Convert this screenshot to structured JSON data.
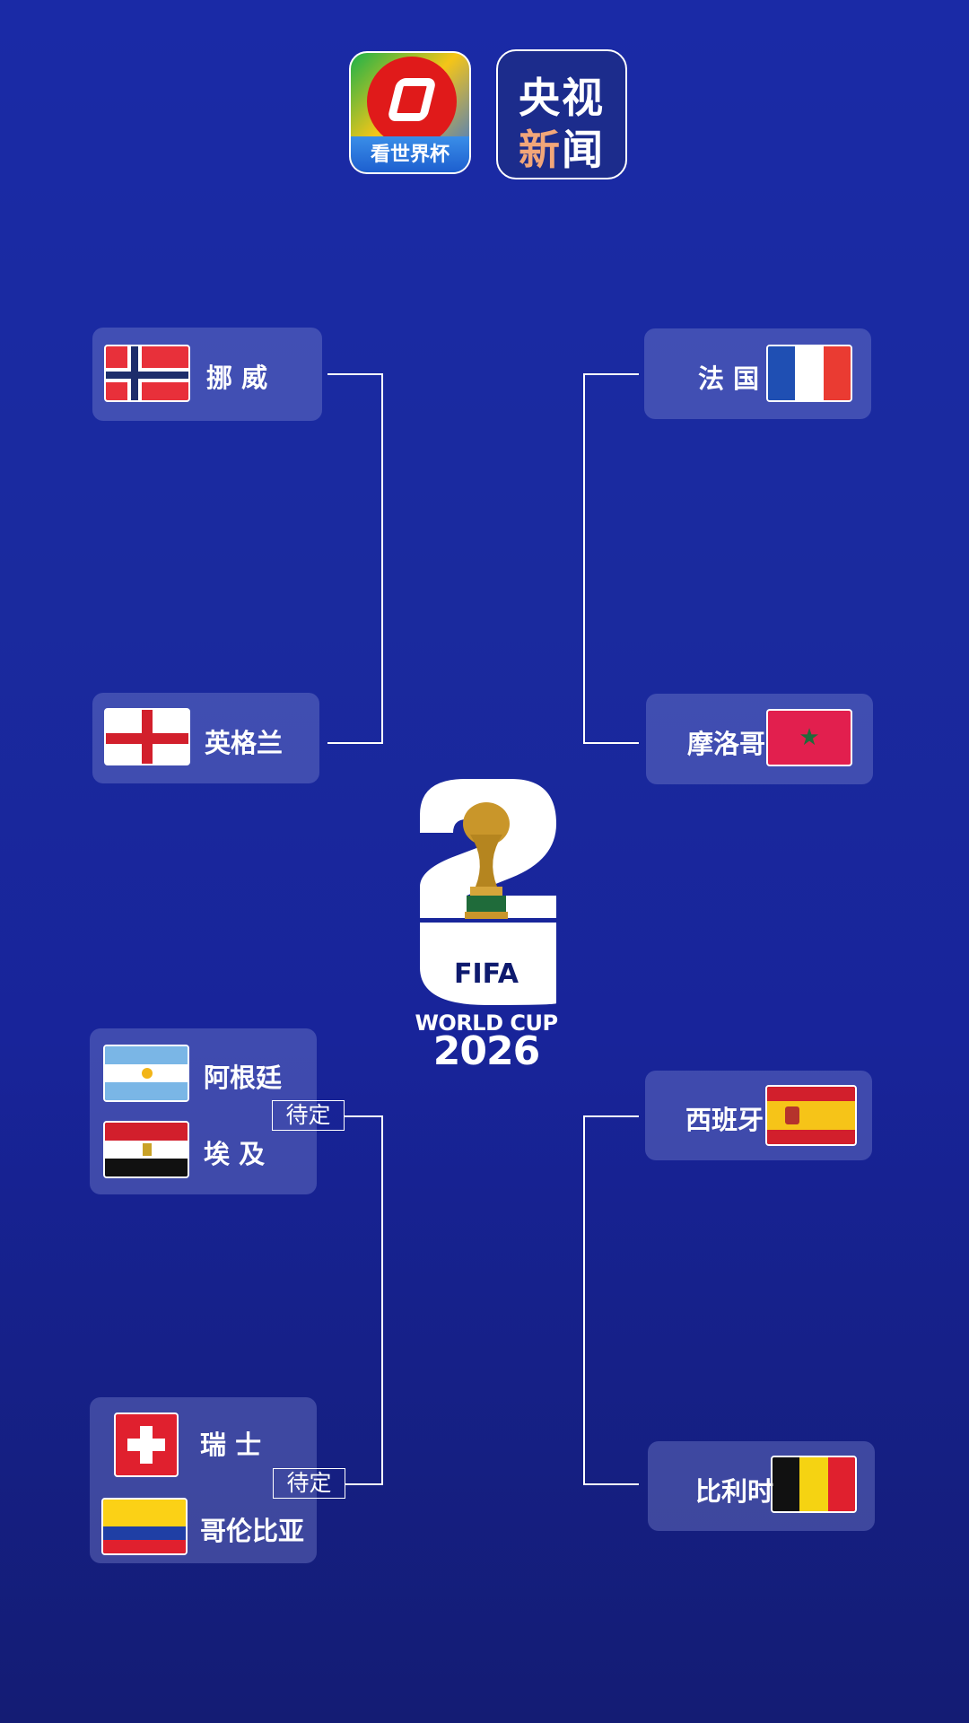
{
  "logos": {
    "app_caption": "看世界杯",
    "news_line1": "央视",
    "news_line2_a": "新",
    "news_line2_b": "闻"
  },
  "bracket": {
    "left_top": [
      {
        "name": "挪 威",
        "flag": "norway-flag"
      },
      {
        "name": "英格兰",
        "flag": "england-flag"
      }
    ],
    "right_top": [
      {
        "name": "法 国",
        "flag": "france-flag"
      },
      {
        "name": "摩洛哥",
        "flag": "morocco-flag"
      }
    ],
    "left_bottom": [
      {
        "teams": [
          {
            "name": "阿根廷",
            "flag": "argentina-flag"
          },
          {
            "name": "埃 及",
            "flag": "egypt-flag"
          }
        ],
        "status": "待定"
      },
      {
        "teams": [
          {
            "name": "瑞 士",
            "flag": "switzerland-flag"
          },
          {
            "name": "哥伦比亚",
            "flag": "colombia-flag"
          }
        ],
        "status": "待定"
      }
    ],
    "right_bottom": [
      {
        "name": "西班牙",
        "flag": "spain-flag"
      },
      {
        "name": "比利时",
        "flag": "belgium-flag"
      }
    ]
  },
  "center_logo": {
    "fifa": "FIFA",
    "world_cup": "WORLD CUP",
    "year": "2026"
  },
  "colors": {
    "background_top": "#1a2aa6",
    "background_bottom": "#141c74",
    "card": "#5a63b8"
  }
}
